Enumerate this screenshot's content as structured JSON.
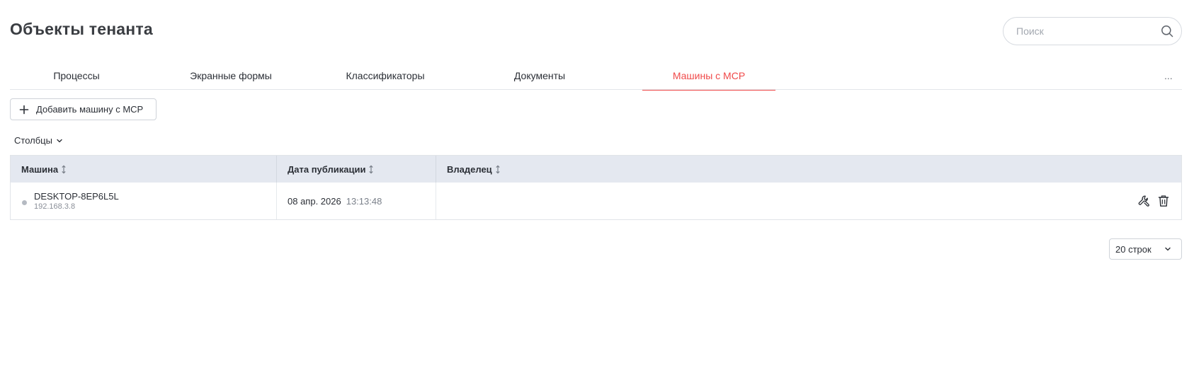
{
  "header": {
    "title": "Объекты тенанта",
    "search": {
      "placeholder": "Поиск",
      "value": ""
    }
  },
  "tabs": [
    {
      "label": "Процессы",
      "active": false
    },
    {
      "label": "Экранные формы",
      "active": false
    },
    {
      "label": "Классификаторы",
      "active": false
    },
    {
      "label": "Документы",
      "active": false
    },
    {
      "label": "Машины с MCP",
      "active": true
    }
  ],
  "tabs_more_label": "...",
  "toolbar": {
    "add_label": "Добавить машину с MCP"
  },
  "columns_toggle_label": "Столбцы",
  "table": {
    "headers": [
      "Машина",
      "Дата публикации",
      "Владелец"
    ],
    "rows": [
      {
        "machine_name": "DESKTOP-8EP6L5L",
        "machine_ip": "192.168.3.8",
        "pub_date": "08 апр. 2026",
        "pub_time": "13:13:48",
        "owner": ""
      }
    ]
  },
  "pagination": {
    "page_size_label": "20 строк"
  },
  "icons": {
    "search": "search-icon",
    "add": "plus-icon",
    "columns": "chevron-down-icon",
    "sort": "sort-icon",
    "settings": "wrench-icon",
    "delete": "trash-icon",
    "status": "status-dot"
  },
  "colors": {
    "accent": "#f04a4a",
    "table_header_bg": "#e4e8f0",
    "status_offline": "#b5bac2"
  }
}
